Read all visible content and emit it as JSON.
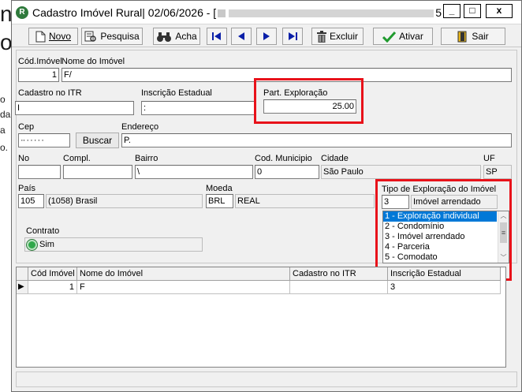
{
  "background": {
    "big_letters": [
      "n",
      "o"
    ],
    "small_lines": [
      "o",
      "da",
      "a",
      "o."
    ]
  },
  "window": {
    "title": "Cadastro Imóvel Rural|  02/06/2026 - [",
    "title_tail": "5...",
    "min_label": "_",
    "max_label": "□",
    "close_label": "x"
  },
  "toolbar": {
    "novo": "Novo",
    "pesquisa": "Pesquisa",
    "acha": "Acha",
    "excluir": "Excluir",
    "ativar": "Ativar",
    "sair": "Sair"
  },
  "form": {
    "cod_imovel_label": "Cód.Imóvel",
    "cod_imovel_value": "1",
    "nome_imovel_label": "Nome do Imóvel",
    "nome_imovel_value": "F/",
    "cadastro_itr_label": "Cadastro no ITR",
    "cadastro_itr_value": "I",
    "inscricao_estadual_label": "Inscrição Estadual",
    "inscricao_estadual_value": ":",
    "part_exploracao_label": "Part. Exploração",
    "part_exploracao_value": "25.00",
    "cep_label": "Cep",
    "cep_value": "·· · · · · ·",
    "buscar_label": "Buscar",
    "endereco_label": "Endereço",
    "endereco_value": "P.",
    "no_label": "No",
    "no_value": "",
    "compl_label": "Compl.",
    "compl_value": "",
    "bairro_label": "Bairro",
    "bairro_value": "\\",
    "cod_municipio_label": "Cod. Municipio",
    "cod_municipio_value": "0",
    "cidade_label": "Cidade",
    "cidade_value": "São Paulo",
    "uf_label": "UF",
    "uf_value": "SP",
    "pais_label": "País",
    "pais_code": "105",
    "pais_name": "(1058) Brasil",
    "moeda_label": "Moeda",
    "moeda_code": "BRL",
    "moeda_name": "REAL",
    "tipo_exploracao_label": "Tipo de Exploração do Imóvel",
    "tipo_exploracao_code": "3",
    "tipo_exploracao_name": "Imóvel arrendado",
    "tipo_exploracao_options": [
      "1 - Exploração individual",
      "2 - Condomínio",
      "3 - Imóvel arrendado",
      "4 - Parceria",
      "5 - Comodato"
    ],
    "contrato_label": "Contrato",
    "contrato_value": "Sim"
  },
  "grid": {
    "columns": [
      "Cód Imóvel",
      "Nome do Imóvel",
      "Cadastro no ITR",
      "Inscrição Estadual"
    ],
    "rows": [
      {
        "pointer": "▶",
        "cod": "1",
        "nome": "F",
        "itr": "",
        "ie": "3"
      }
    ]
  },
  "colors": {
    "highlight_border": "#e8121a",
    "selection": "#0078d7"
  }
}
